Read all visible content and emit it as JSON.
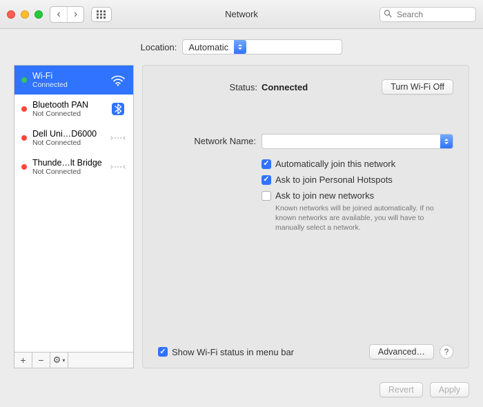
{
  "window": {
    "title": "Network",
    "search_placeholder": "Search"
  },
  "location": {
    "label": "Location:",
    "value": "Automatic"
  },
  "services": [
    {
      "name": "Wi-Fi",
      "status": "Connected",
      "dot": "g",
      "icon": "wifi",
      "selected": true
    },
    {
      "name": "Bluetooth PAN",
      "status": "Not Connected",
      "dot": "r",
      "icon": "bluetooth",
      "selected": false
    },
    {
      "name": "Dell Uni…D6000",
      "status": "Not Connected",
      "dot": "r",
      "icon": "ethernet",
      "selected": false
    },
    {
      "name": "Thunde…lt Bridge",
      "status": "Not Connected",
      "dot": "r",
      "icon": "ethernet",
      "selected": false
    }
  ],
  "sidebar_tools": {
    "add": "+",
    "remove": "−",
    "gear": "⚙︎"
  },
  "detail": {
    "status_label": "Status:",
    "status_value": "Connected",
    "wifi_off_btn": "Turn Wi-Fi Off",
    "network_name_label": "Network Name:",
    "network_name_value": "",
    "auto_join": "Automatically join this network",
    "ask_hotspot": "Ask to join Personal Hotspots",
    "ask_new": "Ask to join new networks",
    "ask_new_help": "Known networks will be joined automatically. If no known networks are available, you will have to manually select a network.",
    "show_menubar": "Show Wi-Fi status in menu bar",
    "advanced_btn": "Advanced…",
    "help_btn": "?"
  },
  "buttons": {
    "revert": "Revert",
    "apply": "Apply"
  }
}
